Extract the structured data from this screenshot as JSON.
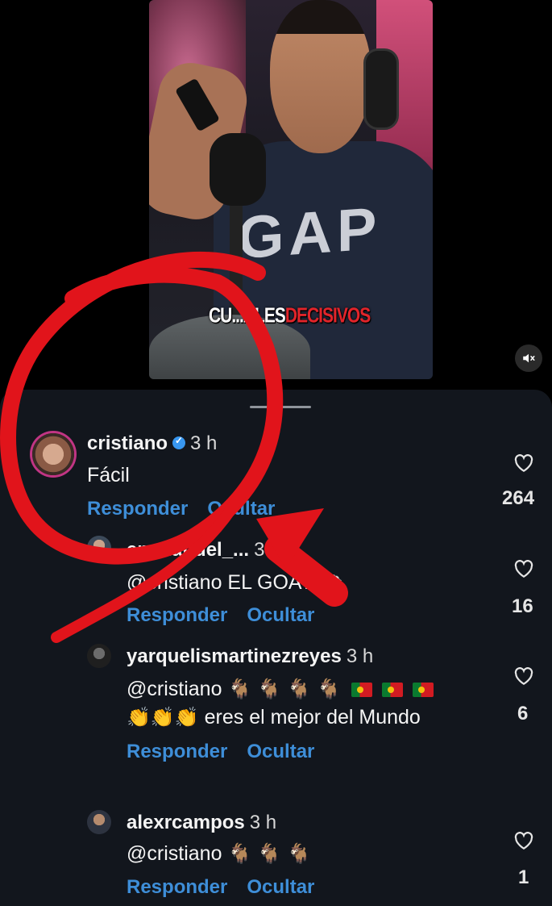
{
  "video": {
    "caption_white": "CU...ALES",
    "caption_red": "DECISIVOS",
    "mute_icon": "speaker-muted-icon"
  },
  "comments": [
    {
      "username": "cristiano",
      "verified": true,
      "time": "3 h",
      "text": "Fácil",
      "reply_label": "Responder",
      "hide_label": "Ocultar",
      "likes": "264"
    },
    {
      "username": "emmanuel_...",
      "time": "3 h",
      "text": "@cristiano EL GOAT 🐑",
      "reply_label": "Responder",
      "hide_label": "Ocultar",
      "likes": "16"
    },
    {
      "username": "yarquelismartinezreyes",
      "time": "3 h",
      "mention": "@cristiano",
      "text_line2": "eres el mejor del Mundo",
      "reply_label": "Responder",
      "hide_label": "Ocultar",
      "likes": "6"
    },
    {
      "username": "alexrcampos",
      "time": "3 h",
      "mention": "@cristiano",
      "reply_label": "Responder",
      "hide_label": "Ocultar",
      "likes": "1"
    }
  ],
  "emoji": {
    "goat": "🐐",
    "clap": "👏"
  },
  "colors": {
    "panel_bg": "#12161d",
    "link_blue": "#3e8ed8",
    "annotation_red": "#e1141b",
    "verified_blue": "#3897f0"
  }
}
